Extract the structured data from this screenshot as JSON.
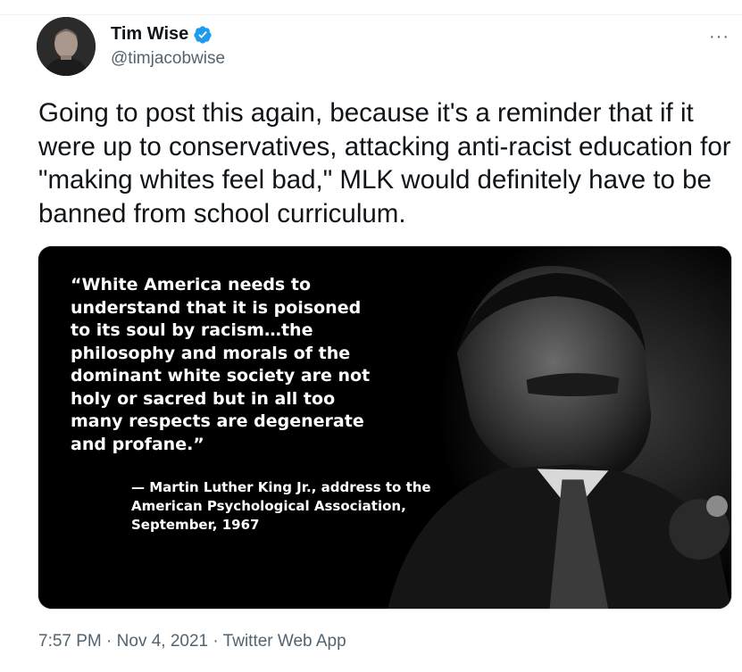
{
  "author": {
    "name": "Tim Wise",
    "handle": "@timjacobwise",
    "verified": true,
    "avatar_icon": "profile-photo",
    "verified_color": "#1d9bf0"
  },
  "tweet": {
    "text": "Going to post this again, because it's a reminder that if it were up to conservatives, attacking anti-racist education for \"making whites feel bad,\" MLK would definitely have to be banned from school curriculum."
  },
  "media": {
    "quote": "“White America needs to\nunderstand that it is poisoned\nto its soul by racism…the\nphilosophy and morals of the\ndominant white society are not\nholy or sacred but in all too\nmany respects are degenerate\nand profane.”",
    "attribution": "— Martin Luther King Jr., address to the\nAmerican Psychological Association,\nSeptember, 1967"
  },
  "meta": {
    "time": "7:57 PM",
    "separator": "·",
    "date": "Nov 4, 2021",
    "source": "Twitter Web App"
  },
  "more_icon": "more-horizontal-icon",
  "more_label": "···"
}
